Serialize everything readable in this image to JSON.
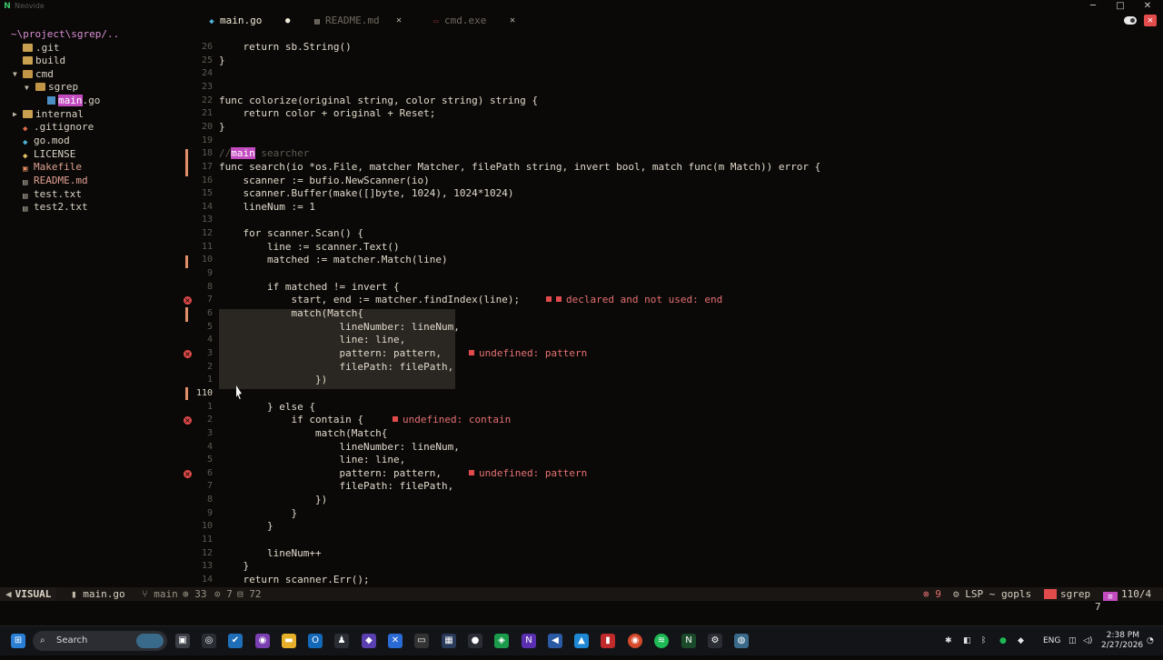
{
  "window": {
    "title": "Neovide",
    "controls": {
      "minimize": "─",
      "maximize": "□",
      "close": "✕"
    }
  },
  "tabs": [
    {
      "label": "main.go",
      "modified_dot": "●",
      "icon": "go-file-icon"
    },
    {
      "label": "README.md",
      "close": "✕",
      "icon": "markdown-file-icon"
    },
    {
      "label": "cmd.exe",
      "close": "✕",
      "icon": "terminal-icon"
    }
  ],
  "tree": {
    "root": "~\\project\\sgrep/..",
    "items": [
      {
        "label": ".git",
        "type": "folder"
      },
      {
        "label": "build",
        "type": "folder"
      },
      {
        "label": "cmd",
        "type": "folder-open"
      },
      {
        "label": "sgrep",
        "type": "folder-open"
      },
      {
        "label_hl": "main",
        "label_rest": ".go",
        "type": "go-file"
      },
      {
        "label": "internal",
        "type": "folder"
      },
      {
        "label": ".gitignore",
        "type": "git-file"
      },
      {
        "label": "go.mod",
        "type": "go-file"
      },
      {
        "label": "LICENSE",
        "type": "license-file"
      },
      {
        "label": "Makefile",
        "type": "make-file"
      },
      {
        "label": "README.md",
        "type": "md-file"
      },
      {
        "label": "test.txt",
        "type": "text-file"
      },
      {
        "label": "test2.txt",
        "type": "text-file"
      }
    ]
  },
  "editor": {
    "lines": [
      {
        "num": "26",
        "text": "    return sb.String()"
      },
      {
        "num": "25",
        "text": "}"
      },
      {
        "num": "24",
        "text": ""
      },
      {
        "num": "23",
        "text": ""
      },
      {
        "num": "22",
        "text": "func colorize(original string, color string) string {"
      },
      {
        "num": "21",
        "text": "    return color + original + Reset;"
      },
      {
        "num": "20",
        "text": "}"
      },
      {
        "num": "19",
        "text": ""
      },
      {
        "num": "18",
        "text": "",
        "comment_prefix": "//",
        "comment_hl": "main",
        "comment_rest": " searcher"
      },
      {
        "num": "17",
        "text": "func search(io *os.File, matcher Matcher, filePath string, invert bool, match func(m Match)) error {"
      },
      {
        "num": "16",
        "text": "    scanner := bufio.NewScanner(io)"
      },
      {
        "num": "15",
        "text": "    scanner.Buffer(make([]byte, 1024), 1024*1024)"
      },
      {
        "num": "14",
        "text": "    lineNum := 1"
      },
      {
        "num": "13",
        "text": ""
      },
      {
        "num": "12",
        "text": "    for scanner.Scan() {"
      },
      {
        "num": "11",
        "text": "        line := scanner.Text()"
      },
      {
        "num": "10",
        "text": "        matched := matcher.Match(line)"
      },
      {
        "num": "9",
        "text": ""
      },
      {
        "num": "8",
        "text": "        if matched != invert {"
      },
      {
        "num": "7",
        "text": "            start, end := matcher.findIndex(line);"
      },
      {
        "num": "6",
        "text": "            match(Match{"
      },
      {
        "num": "5",
        "text": "                    lineNumber: lineNum,"
      },
      {
        "num": "4",
        "text": "                    line: line,"
      },
      {
        "num": "3",
        "text": "                    pattern: pattern,"
      },
      {
        "num": "2",
        "text": "                    filePath: filePath,"
      },
      {
        "num": "1",
        "text": "                })"
      },
      {
        "num": "110",
        "text": ""
      },
      {
        "num": "1",
        "text": "        } else {"
      },
      {
        "num": "2",
        "text": "            if contain {"
      },
      {
        "num": "3",
        "text": "                match(Match{"
      },
      {
        "num": "4",
        "text": "                    lineNumber: lineNum,"
      },
      {
        "num": "5",
        "text": "                    line: line,"
      },
      {
        "num": "6",
        "text": "                    pattern: pattern,"
      },
      {
        "num": "7",
        "text": "                    filePath: filePath,"
      },
      {
        "num": "8",
        "text": "                })"
      },
      {
        "num": "9",
        "text": "            }"
      },
      {
        "num": "10",
        "text": "        }"
      },
      {
        "num": "11",
        "text": ""
      },
      {
        "num": "12",
        "text": "        lineNum++"
      },
      {
        "num": "13",
        "text": "    }"
      },
      {
        "num": "14",
        "text": "    return scanner.Err();"
      }
    ],
    "diagnostics": [
      {
        "line_index": 19,
        "text": "declared and not used: end",
        "double": true
      },
      {
        "line_index": 23,
        "text": "undefined: pattern"
      },
      {
        "line_index": 28,
        "text": "undefined: contain"
      },
      {
        "line_index": 32,
        "text": "undefined: pattern"
      }
    ]
  },
  "statusline": {
    "mode": "VISUAL",
    "file": "main.go",
    "branch": "main",
    "added": "33",
    "changed": "7",
    "removed": "72",
    "errors": "9",
    "lsp": "LSP ~ gopls",
    "project": "sgrep",
    "position": "110/4"
  },
  "cmdline": {
    "count": "7"
  },
  "taskbar": {
    "search_label": "Search",
    "lang": "ENG",
    "time": "2:38 PM",
    "date": "2/27/2026"
  },
  "colors": {
    "accent": "#c24bc0",
    "error": "#e24b4b",
    "git_change": "#e08f6a",
    "folder": "#c8a050"
  }
}
